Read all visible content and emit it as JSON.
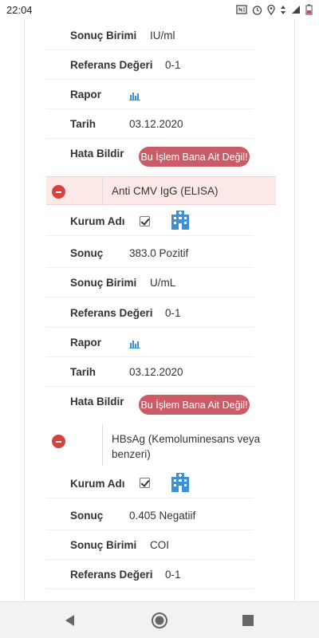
{
  "status": {
    "time": "22:04"
  },
  "top_block": {
    "unit": {
      "label": "Sonuç Birimi",
      "value": "IU/ml"
    },
    "ref": {
      "label": "Referans Değeri",
      "value": "0-1"
    },
    "report": {
      "label": "Rapor",
      "icon": "bar-chart-icon"
    },
    "date": {
      "label": "Tarih",
      "value": "03.12.2020"
    },
    "error": {
      "label": "Hata Bildir",
      "button": "Bu İşlem Bana Ait Değil!"
    }
  },
  "tests": [
    {
      "title": "Anti CMV IgG (ELISA)",
      "institution": {
        "label": "Kurum Adı"
      },
      "result": {
        "label": "Sonuç",
        "value": "383.0 Pozitif"
      },
      "unit": {
        "label": "Sonuç Birimi",
        "value": "U/mL"
      },
      "ref": {
        "label": "Referans Değeri",
        "value": "0-1"
      },
      "report": {
        "label": "Rapor"
      },
      "date": {
        "label": "Tarih",
        "value": "03.12.2020"
      },
      "error": {
        "label": "Hata Bildir",
        "button": "Bu İşlem Bana Ait Değil!"
      }
    },
    {
      "title_line1": "HBsAg (Kemoluminesans veya",
      "title_line2": "benzeri)",
      "institution": {
        "label": "Kurum Adı"
      },
      "result": {
        "label": "Sonuç",
        "value": "0.405 Negatiif"
      },
      "unit": {
        "label": "Sonuç Birimi",
        "value": "COI"
      },
      "ref": {
        "label": "Referans Değeri",
        "value": "0-1"
      }
    }
  ],
  "colors": {
    "accent_red": "#cb5b66",
    "minus_red": "#d9413f",
    "header_bg": "#fde8e8",
    "icon_blue": "#3d8fd6"
  }
}
